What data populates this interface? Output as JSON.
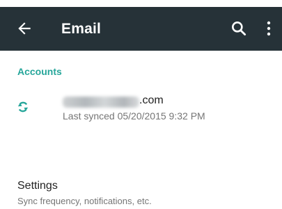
{
  "appbar": {
    "title": "Email",
    "back_icon": "arrow-back-icon",
    "search_icon": "search-icon",
    "more_icon": "more-vert-icon",
    "background": "#263238"
  },
  "accounts": {
    "header": "Accounts",
    "accent": "#26a69a",
    "items": [
      {
        "email_visible": ".com",
        "last_synced": "Last synced 05/20/2015 9:32 PM",
        "icon": "sync-icon"
      }
    ]
  },
  "settings": {
    "title": "Settings",
    "subtitle": "Sync frequency, notifications, etc."
  }
}
